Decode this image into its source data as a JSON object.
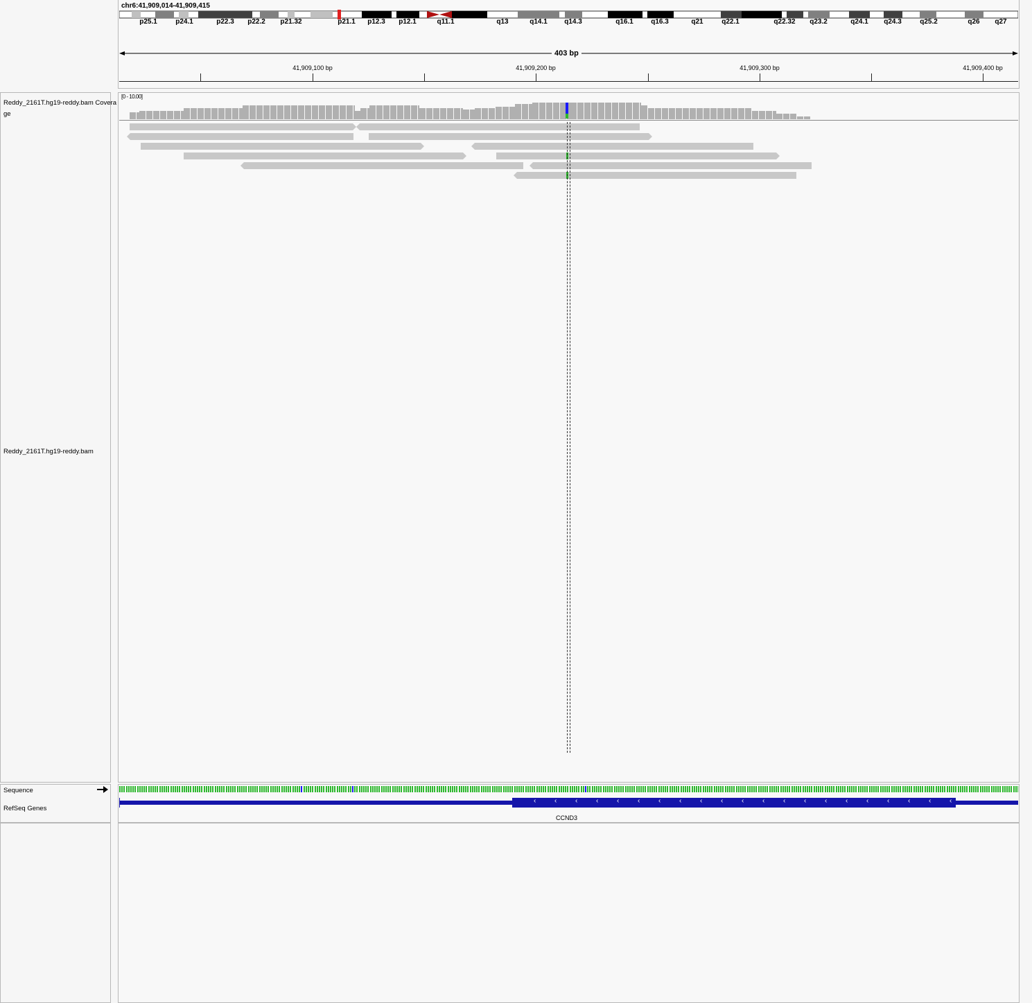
{
  "locus": "chr6:41,909,014-41,909,415",
  "ideogram": {
    "bands": [
      "p25.1",
      "p24.1",
      "p22.3",
      "p22.2",
      "p21.32",
      "p21.1",
      "p12.3",
      "p12.1",
      "q11.1",
      "q13",
      "q14.1",
      "q14.3",
      "q16.1",
      "q16.3",
      "q21",
      "q22.1",
      "q22.32",
      "q23.2",
      "q24.1",
      "q24.3",
      "q25.2",
      "q26",
      "q27"
    ]
  },
  "ruler": {
    "span_label": "403 bp",
    "ticks": [
      "41,909,100 bp",
      "41,909,200 bp",
      "41,909,300 bp",
      "41,909,400 bp"
    ]
  },
  "tracks": {
    "coverage_name": "Reddy_2161T.hg19-reddy.bam Coverage",
    "coverage_range": "[0 - 10.00]",
    "alignment_name": "Reddy_2161T.hg19-reddy.bam",
    "sequence_name": "Sequence",
    "genes_name": "RefSeq Genes"
  },
  "gene": {
    "name": "CCND3",
    "strand": "minus"
  },
  "colors": {
    "ideogram_red": "#e02020",
    "read_gray": "#c8c8c8",
    "coverage_gray": "#b0b0b0",
    "gene_blue": "#1515aa",
    "snp_green": "#2db82d",
    "snp_blue": "#1a1aff"
  }
}
